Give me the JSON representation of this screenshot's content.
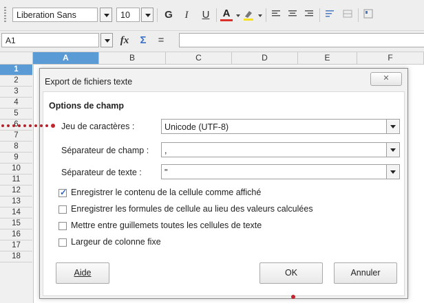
{
  "toolbar": {
    "font_name": "Liberation Sans",
    "font_size": "10",
    "bold_glyph": "G",
    "italic_glyph": "I",
    "underline_glyph": "U",
    "font_color_glyph": "A"
  },
  "formula_bar": {
    "cell_ref": "A1",
    "function_wizard_glyph": "fx",
    "sum_glyph": "Σ",
    "equals_glyph": "="
  },
  "sheet": {
    "columns": [
      "A",
      "B",
      "C",
      "D",
      "E",
      "F"
    ],
    "rows": [
      "1",
      "2",
      "3",
      "4",
      "5",
      "6",
      "7",
      "8",
      "9",
      "10",
      "11",
      "12",
      "13",
      "14",
      "15",
      "16",
      "17",
      "18"
    ]
  },
  "dialog": {
    "title": "Export de fichiers texte",
    "section_title": "Options de champ",
    "charset_label": "Jeu de caractères :",
    "charset_value": "Unicode (UTF-8)",
    "field_sep_label": "Séparateur de champ :",
    "field_sep_value": ",",
    "text_sep_label": "Séparateur de texte :",
    "text_sep_value": "\"",
    "options": [
      {
        "label": "Enregistrer le contenu de la cellule comme affiché",
        "checked": true
      },
      {
        "label": "Enregistrer les formules de cellule au lieu des valeurs calculées",
        "checked": false
      },
      {
        "label": "Mettre entre guillemets toutes les cellules de texte",
        "checked": false
      },
      {
        "label": "Largeur de colonne fixe",
        "checked": false
      }
    ],
    "help_button": "Aide",
    "ok_button": "OK",
    "cancel_button": "Annuler"
  },
  "colors": {
    "accent": "#5b9bd5",
    "annotation": "#c0262d"
  },
  "icons": [
    "close-icon",
    "chevron-down-icon",
    "check-icon",
    "highlight-icon",
    "align-left-icon",
    "align-center-icon",
    "align-right-icon",
    "wrap-text-icon",
    "merge-cells-icon"
  ]
}
